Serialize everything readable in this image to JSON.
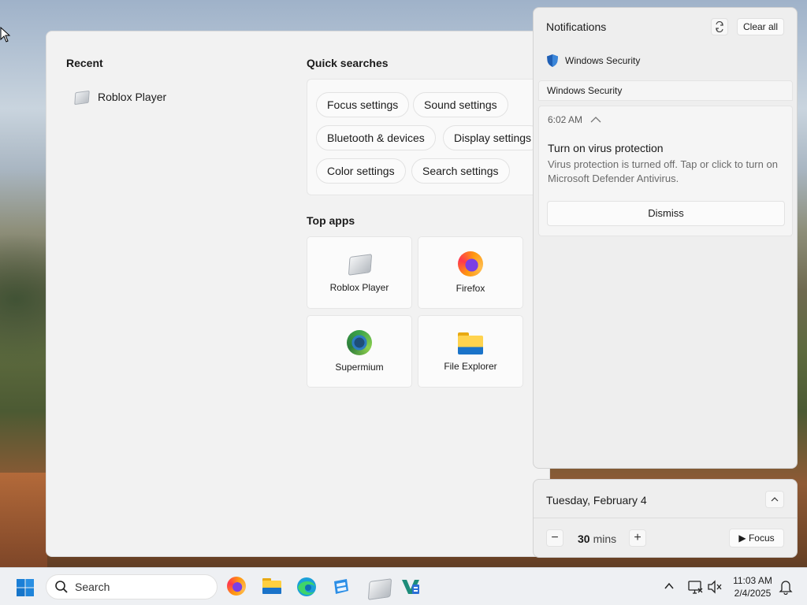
{
  "start_panel": {
    "recent_title": "Recent",
    "recent_items": [
      {
        "label": "Roblox Player",
        "icon": "roblox-icon"
      }
    ],
    "quick_searches_title": "Quick searches",
    "quick_searches": [
      "Focus settings",
      "Sound settings",
      "Bluetooth & devices",
      "Display settings",
      "Color settings",
      "Search settings"
    ],
    "top_apps_title": "Top apps",
    "top_apps": [
      {
        "label": "Roblox Player",
        "icon": "roblox-icon"
      },
      {
        "label": "Firefox",
        "icon": "firefox-icon"
      },
      {
        "label": "Supermium",
        "icon": "supermium-icon"
      },
      {
        "label": "File Explorer",
        "icon": "file-explorer-icon"
      }
    ]
  },
  "notifications": {
    "title": "Notifications",
    "settings_icon": "notification-settings-icon",
    "clear_all": "Clear all",
    "app_name": "Windows Security",
    "group_label": "Windows Security",
    "toast": {
      "time": "6:02 AM",
      "title": "Turn on virus protection",
      "body": "Virus protection is turned off. Tap or click to turn on Microsoft Defender Antivirus.",
      "dismiss": "Dismiss"
    }
  },
  "calendar": {
    "date": "Tuesday, February 4",
    "focus_minutes": "30",
    "minutes_unit": "mins",
    "decrement": "−",
    "increment": "+",
    "focus_label": "Focus"
  },
  "taskbar": {
    "search_placeholder": "Search",
    "pinned_apps": [
      "firefox-icon",
      "file-explorer-icon",
      "edge-icon",
      "store-icon",
      "roblox-icon",
      "visual-studio-icon"
    ],
    "clock_time": "11:03 AM",
    "clock_date": "2/4/2025"
  },
  "colors": {
    "accent": "#0067c0",
    "shield": "#1f5fb5",
    "panel_bg": "#f2f2f2",
    "taskbar_bg": "#eef0f3"
  }
}
